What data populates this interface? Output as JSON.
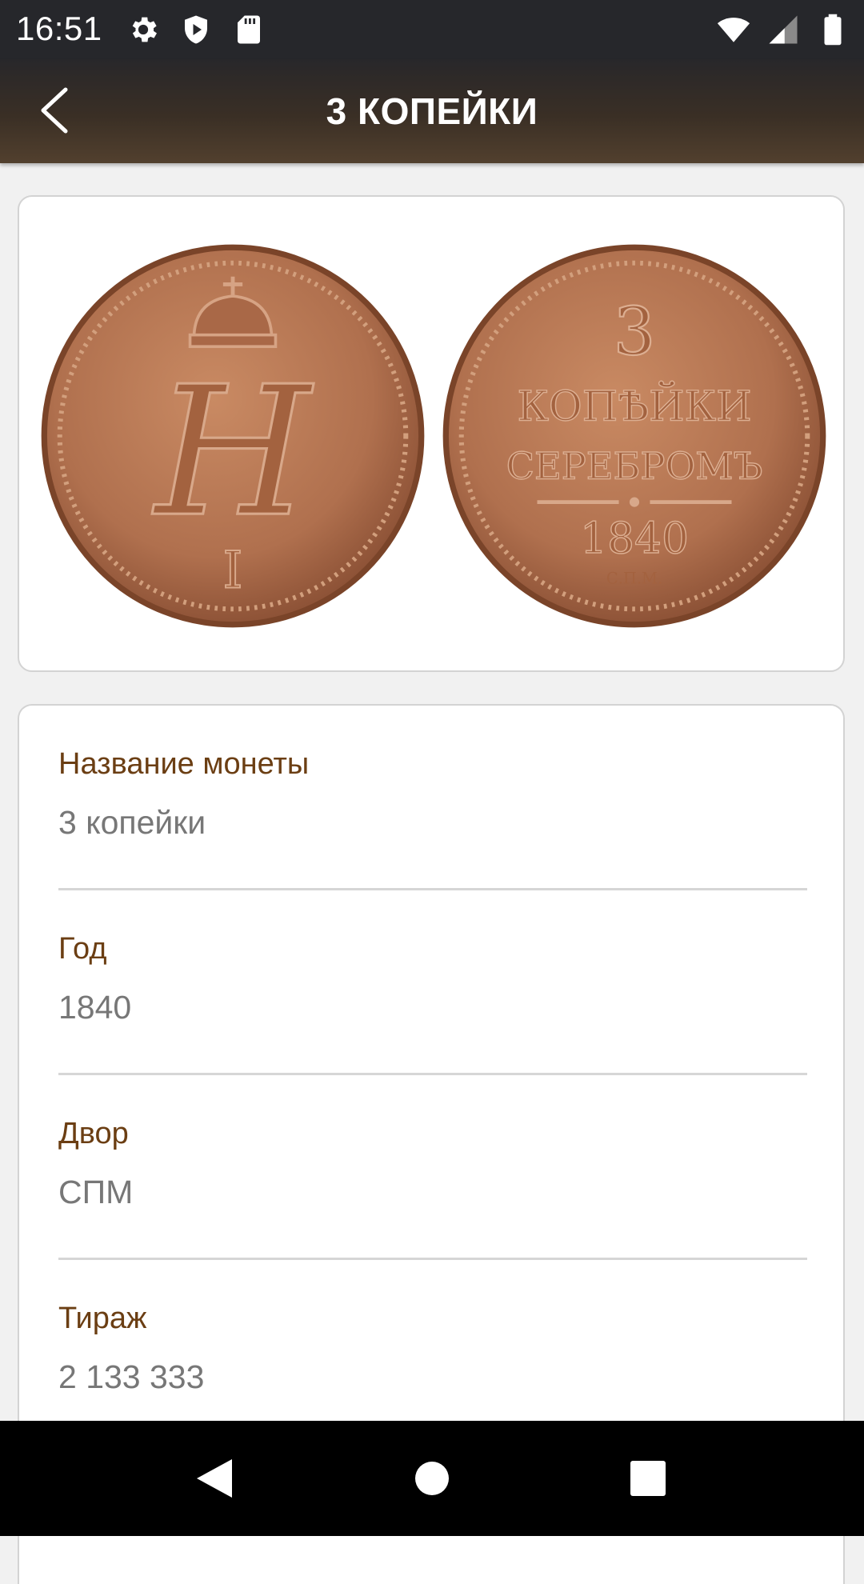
{
  "status_bar": {
    "time": "16:51",
    "left_icons": [
      "gear-icon",
      "shield-play-icon",
      "sd-card-icon"
    ],
    "right_icons": [
      "wifi-icon",
      "cell-signal-icon",
      "battery-icon"
    ]
  },
  "app_bar": {
    "title": "3 КОПЕЙКИ",
    "back_icon": "chevron-left-icon"
  },
  "coin_images": {
    "obverse": {
      "monogram": "Н",
      "numeral": "I"
    },
    "reverse": {
      "line1": "3",
      "line2": "КОПѢЙКИ",
      "line3": "СЕРЕБРОМЪ",
      "line4": "1840",
      "line5": "С.П.М."
    }
  },
  "details": [
    {
      "label": "Название монеты",
      "value": "3 копейки"
    },
    {
      "label": "Год",
      "value": "1840"
    },
    {
      "label": "Двор",
      "value": "СПМ"
    },
    {
      "label": "Тираж",
      "value": "2 133 333"
    }
  ],
  "nav_bar": {
    "icons": [
      "nav-back-icon",
      "nav-home-icon",
      "nav-recents-icon"
    ]
  },
  "colors": {
    "label": "#6b3e13",
    "value": "#777777",
    "coin": "#b0704e",
    "status_bar": "#26272b"
  }
}
